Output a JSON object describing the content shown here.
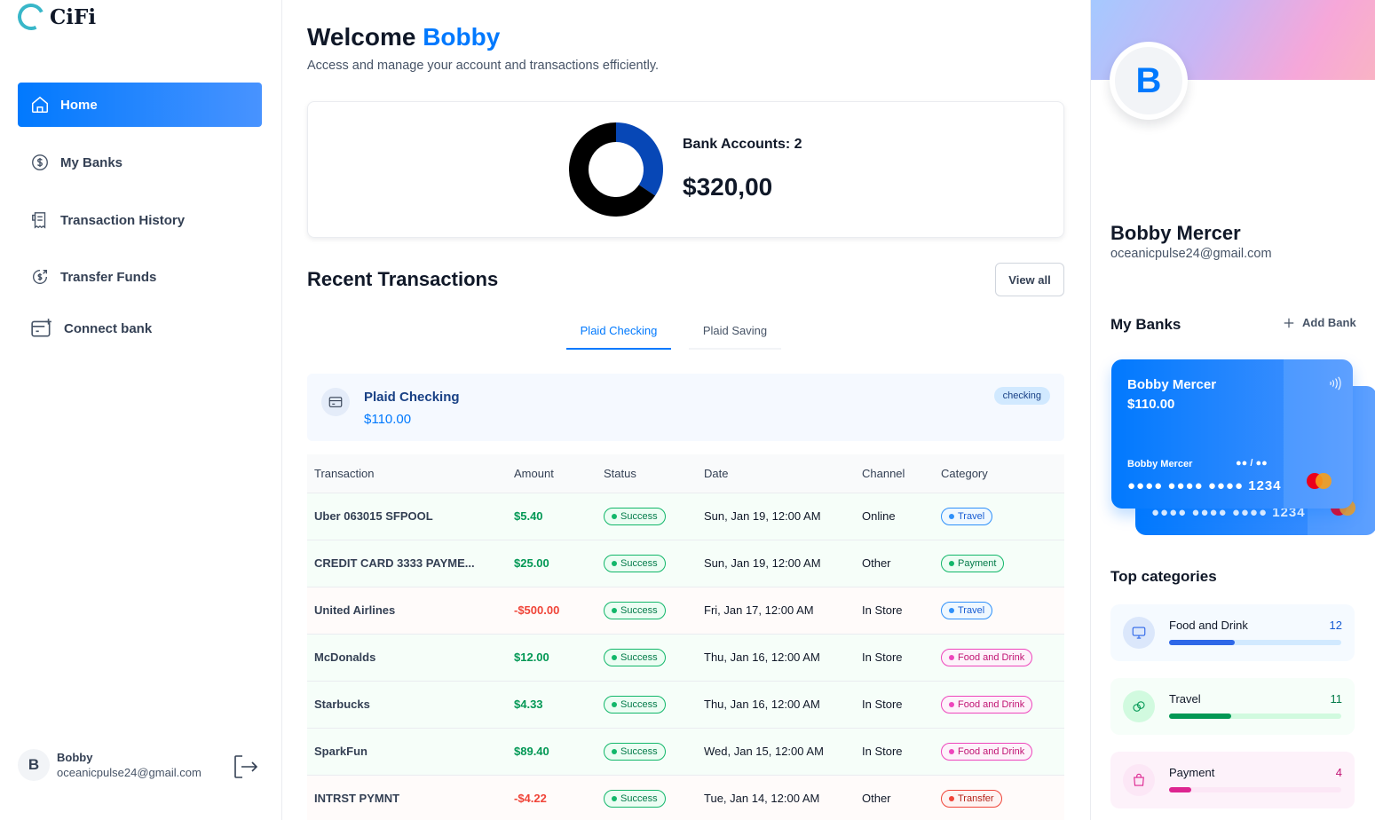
{
  "app": {
    "name": "CiFi"
  },
  "sidebar": {
    "items": [
      {
        "label": "Home",
        "icon": "home-icon",
        "active": true
      },
      {
        "label": "My Banks",
        "icon": "dollar-circle-icon"
      },
      {
        "label": "Transaction History",
        "icon": "receipt-icon"
      },
      {
        "label": "Transfer Funds",
        "icon": "money-send-icon"
      },
      {
        "label": "Connect bank",
        "icon": "card-add-icon"
      }
    ],
    "user": {
      "initial": "B",
      "name": "Bobby",
      "email": "oceanicpulse24@gmail.com"
    }
  },
  "header": {
    "greeting": "Welcome",
    "name": "Bobby",
    "subtitle": "Access and manage your account and transactions efficiently."
  },
  "balance": {
    "accounts_label": "Bank Accounts: 2",
    "total": "$320,00",
    "chart_data": {
      "type": "pie",
      "values": [
        110,
        210
      ],
      "colors": [
        "#0747b6",
        "#000000"
      ]
    }
  },
  "recent": {
    "title": "Recent Transactions",
    "view_all": "View all",
    "tabs": [
      "Plaid Checking",
      "Plaid Saving"
    ],
    "account": {
      "name": "Plaid Checking",
      "balance": "$110.00",
      "type": "checking"
    },
    "columns": [
      "Transaction",
      "Amount",
      "Status",
      "Date",
      "Channel",
      "Category"
    ],
    "rows": [
      {
        "name": "Uber 063015 SFPOOL",
        "amount": "$5.40",
        "sign": "pos",
        "status": "Success",
        "date": "Sun, Jan 19, 12:00 AM",
        "channel": "Online",
        "category": "Travel",
        "cat": "travel"
      },
      {
        "name": "CREDIT CARD 3333 PAYME...",
        "amount": "$25.00",
        "sign": "pos",
        "status": "Success",
        "date": "Sun, Jan 19, 12:00 AM",
        "channel": "Other",
        "category": "Payment",
        "cat": "payment"
      },
      {
        "name": "United Airlines",
        "amount": "-$500.00",
        "sign": "neg",
        "status": "Success",
        "date": "Fri, Jan 17, 12:00 AM",
        "channel": "In Store",
        "category": "Travel",
        "cat": "travel"
      },
      {
        "name": "McDonalds",
        "amount": "$12.00",
        "sign": "pos",
        "status": "Success",
        "date": "Thu, Jan 16, 12:00 AM",
        "channel": "In Store",
        "category": "Food and Drink",
        "cat": "food"
      },
      {
        "name": "Starbucks",
        "amount": "$4.33",
        "sign": "pos",
        "status": "Success",
        "date": "Thu, Jan 16, 12:00 AM",
        "channel": "In Store",
        "category": "Food and Drink",
        "cat": "food"
      },
      {
        "name": "SparkFun",
        "amount": "$89.40",
        "sign": "pos",
        "status": "Success",
        "date": "Wed, Jan 15, 12:00 AM",
        "channel": "In Store",
        "category": "Food and Drink",
        "cat": "food"
      },
      {
        "name": "INTRST PYMNT",
        "amount": "-$4.22",
        "sign": "neg",
        "status": "Success",
        "date": "Tue, Jan 14, 12:00 AM",
        "channel": "Other",
        "category": "Transfer",
        "cat": "transfer"
      }
    ]
  },
  "profile": {
    "initial": "B",
    "name": "Bobby Mercer",
    "email": "oceanicpulse24@gmail.com"
  },
  "banks": {
    "title": "My Banks",
    "add_label": "Add Bank",
    "cards": [
      {
        "name": "Bobby Mercer",
        "balance": "$110.00",
        "holder": "Bobby Mercer",
        "expiry": "●● / ●●",
        "number": "●●●● ●●●● ●●●● 1234"
      },
      {
        "number": "●●●● ●●●● ●●●● 1234"
      }
    ]
  },
  "top_categories": {
    "title": "Top categories",
    "items": [
      {
        "name": "Food and Drink",
        "count": "12",
        "fill": 0.38,
        "bg": "#f5faff",
        "track": "#d1e9ff",
        "bar": "#2e67e8",
        "icon_bg": "#dbe7fb",
        "count_color": "#175cd3",
        "icon": "monitor-icon"
      },
      {
        "name": "Travel",
        "count": "11",
        "fill": 0.36,
        "bg": "#f6fef9",
        "track": "#d1fadf",
        "bar": "#039855",
        "icon_bg": "#d1fadf",
        "count_color": "#027a48",
        "icon": "coins-icon"
      },
      {
        "name": "Payment",
        "count": "4",
        "fill": 0.13,
        "bg": "#fdf2fa",
        "track": "#fce7f6",
        "bar": "#dd2590",
        "icon_bg": "#fce7f6",
        "count_color": "#c11574",
        "icon": "shopping-bag-icon"
      }
    ]
  }
}
